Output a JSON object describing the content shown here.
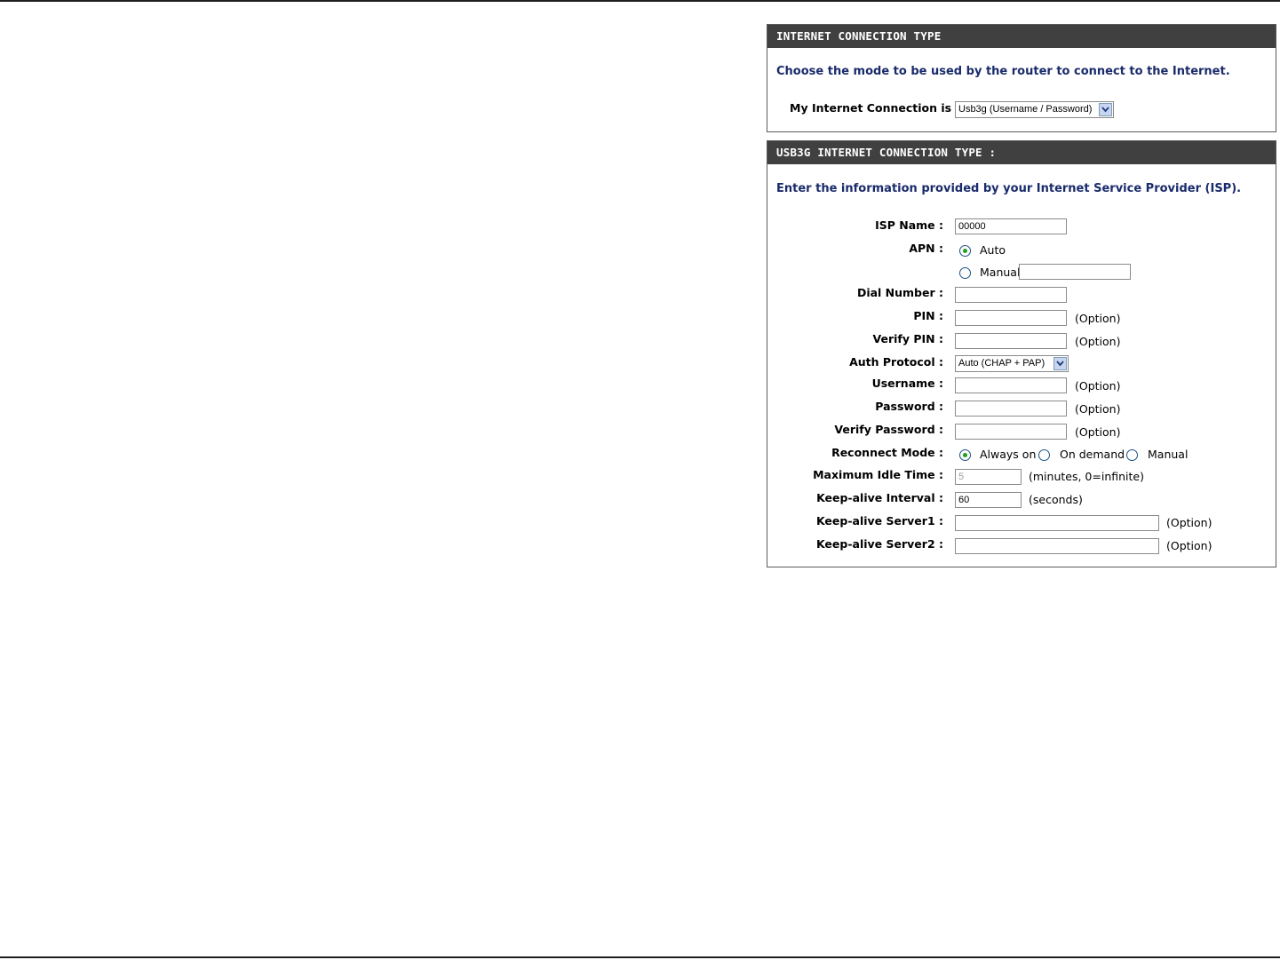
{
  "connection_type": {
    "header": "INTERNET CONNECTION TYPE",
    "intro": "Choose the mode to be used by the router to connect to the Internet.",
    "my_connection_label": "My Internet Connection is :",
    "my_connection_value": "Usb3g (Username / Password)"
  },
  "usb3g": {
    "header": "USB3G INTERNET CONNECTION TYPE :",
    "intro": "Enter the information provided by your Internet Service Provider (ISP).",
    "isp_name_label": "ISP Name :",
    "isp_name_value": "00000",
    "apn_label": "APN :",
    "apn_auto_label": "Auto",
    "apn_manual_label": "Manual",
    "apn_manual_value": "",
    "apn_selected": "Auto",
    "dial_number_label": "Dial Number :",
    "dial_number_value": "",
    "pin_label": "PIN :",
    "pin_value": "",
    "verify_pin_label": "Verify PIN :",
    "verify_pin_value": "",
    "auth_protocol_label": "Auth Protocol :",
    "auth_protocol_value": "Auto (CHAP + PAP)",
    "username_label": "Username :",
    "username_value": "",
    "password_label": "Password :",
    "password_value": "",
    "verify_password_label": "Verify Password :",
    "verify_password_value": "",
    "reconnect_mode_label": "Reconnect Mode :",
    "reconnect_always_on": "Always on",
    "reconnect_on_demand": "On demand",
    "reconnect_manual": "Manual",
    "reconnect_selected": "Always on",
    "max_idle_label": "Maximum Idle Time :",
    "max_idle_value": "5",
    "max_idle_note": "(minutes, 0=infinite)",
    "keepalive_interval_label": "Keep-alive Interval :",
    "keepalive_interval_value": "60",
    "keepalive_interval_note": "(seconds)",
    "keepalive_server1_label": "Keep-alive Server1 :",
    "keepalive_server1_value": "",
    "keepalive_server2_label": "Keep-alive Server2 :",
    "keepalive_server2_value": "",
    "option_note": "(Option)"
  }
}
